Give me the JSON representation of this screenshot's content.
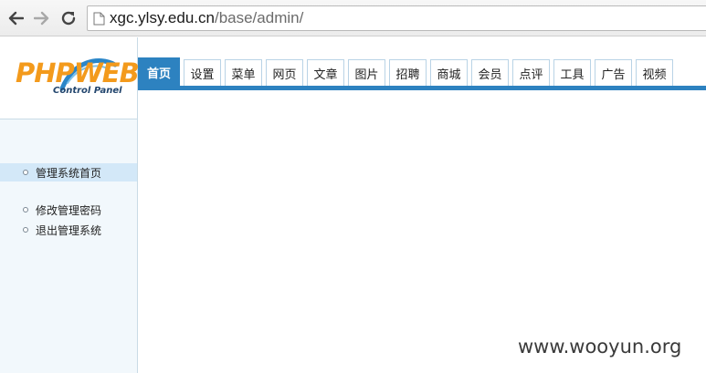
{
  "browser": {
    "url_host": "xgc.ylsy.edu.cn",
    "url_path": "/base/admin/"
  },
  "logo": {
    "word": "PHPWEB",
    "subtitle": "Control Panel"
  },
  "sidebar": {
    "items": [
      {
        "label": "管理系统首页",
        "active": true
      },
      {
        "label": "修改管理密码",
        "active": false
      },
      {
        "label": "退出管理系统",
        "active": false
      }
    ]
  },
  "tabs": [
    {
      "label": "首页",
      "active": true
    },
    {
      "label": "设置"
    },
    {
      "label": "菜单"
    },
    {
      "label": "网页"
    },
    {
      "label": "文章"
    },
    {
      "label": "图片"
    },
    {
      "label": "招聘"
    },
    {
      "label": "商城"
    },
    {
      "label": "会员"
    },
    {
      "label": "点评"
    },
    {
      "label": "工具"
    },
    {
      "label": "广告"
    },
    {
      "label": "视频"
    }
  ],
  "watermark": "www.wooyun.org",
  "colors": {
    "tab_accent": "#2d82c0",
    "logo_orange": "#f39a1c",
    "sidebar_active": "#d3e8f8"
  }
}
